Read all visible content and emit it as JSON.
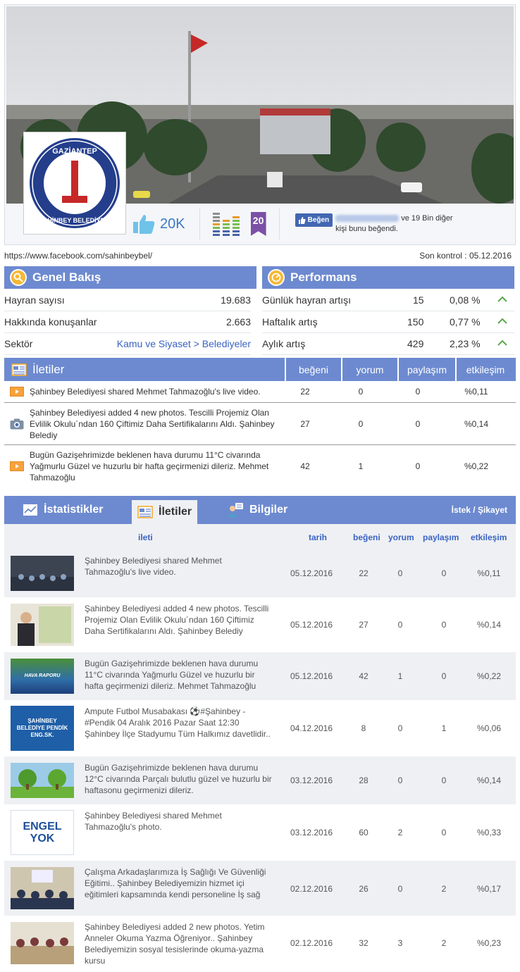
{
  "header": {
    "logo": {
      "text_top": "GAZİANTEP",
      "text_bottom": "ŞAHİNBEY BELEDİYESİ"
    },
    "likes": "20K",
    "rank": "20",
    "fb": {
      "button": "Beğen",
      "text": "ve 19 Bin diğer kişi bunu beğendi."
    }
  },
  "url": "https://www.facebook.com/sahinbeybel/",
  "last_check": "Son kontrol : 05.12.2016",
  "overview": {
    "title": "Genel Bakış",
    "rows": [
      {
        "label": "Hayran sayısı",
        "value": "19.683"
      },
      {
        "label": "Hakkında konuşanlar",
        "value": "2.663"
      },
      {
        "label": "Sektör",
        "value": "Kamu ve Siyaset > Belediyeler"
      }
    ]
  },
  "performance": {
    "title": "Performans",
    "rows": [
      {
        "label": "Günlük hayran artışı",
        "value": "15",
        "pct": "0,08 %"
      },
      {
        "label": "Haftalık artış",
        "value": "150",
        "pct": "0,77 %"
      },
      {
        "label": "Aylık artış",
        "value": "429",
        "pct": "2,23 %"
      }
    ]
  },
  "posts": {
    "headers": [
      "İletiler",
      "beğeni",
      "yorum",
      "paylaşım",
      "etkileşim"
    ],
    "rows": [
      {
        "icon": "video-icon",
        "text": "Şahinbey Belediyesi shared Mehmet Tahmazoğlu's live video.",
        "likes": "22",
        "comments": "0",
        "shares": "0",
        "eng": "%0,11"
      },
      {
        "icon": "camera-icon",
        "text": "Şahinbey Belediyesi added 4 new photos. Tescilli Projemiz Olan Evlilik Okulu´ndan 160 Çiftimiz Daha Sertifikalarını Aldı. Şahinbey Belediy",
        "likes": "27",
        "comments": "0",
        "shares": "0",
        "eng": "%0,14"
      },
      {
        "icon": "video-icon",
        "text": "Bugün Gazişehrimizde beklenen hava durumu 11°C civarında Yağmurlu Güzel ve huzurlu bir hafta geçirmenizi dileriz. Mehmet Tahmazoğlu",
        "likes": "42",
        "comments": "1",
        "shares": "0",
        "eng": "%0,22"
      }
    ]
  },
  "tabs": {
    "stats": "İstatistikler",
    "posts": "İletiler",
    "info": "Bilgiler",
    "request": "İstek / Şikayet"
  },
  "table": {
    "headers": {
      "post": "ileti",
      "date": "tarih",
      "likes": "beğeni",
      "comments": "yorum",
      "shares": "paylaşım",
      "eng": "etkileşim"
    },
    "rows": [
      {
        "text": "Şahinbey Belediyesi shared Mehmet Tahmazoğlu's live video.",
        "date": "05.12.2016",
        "likes": "22",
        "comments": "0",
        "shares": "0",
        "eng": "%0,11"
      },
      {
        "text": "Şahinbey Belediyesi added 4 new photos. Tescilli Projemiz Olan Evlilik Okulu´ndan 160 Çiftimiz Daha Sertifikalarını Aldı. Şahinbey Belediy",
        "date": "05.12.2016",
        "likes": "27",
        "comments": "0",
        "shares": "0",
        "eng": "%0,14"
      },
      {
        "text": "Bugün Gazişehrimizde beklenen hava durumu 11°C civarında Yağmurlu Güzel ve huzurlu bir hafta geçirmenizi dileriz. Mehmet Tahmazoğlu",
        "date": "05.12.2016",
        "likes": "42",
        "comments": "1",
        "shares": "0",
        "eng": "%0,22",
        "thumb_text": "HAVA RAPORU"
      },
      {
        "text": "Ampute Futbol Musabakası ⚽#Şahinbey - #Pendik 04 Aralık 2016 Pazar Saat 12:30 Şahinbey İlçe Stadyumu Tüm Halkımız davetlidir..",
        "date": "04.12.2016",
        "likes": "8",
        "comments": "0",
        "shares": "1",
        "eng": "%0,06",
        "thumb_text": "ŞAHİNBEY BELEDİYE PENDİK ENG.SK."
      },
      {
        "text": "Bugün Gazişehrimizde beklenen hava durumu 12°C civarında Parçalı bulutlu güzel ve huzurlu bir haftasonu geçirmenizi dileriz.",
        "date": "03.12.2016",
        "likes": "28",
        "comments": "0",
        "shares": "0",
        "eng": "%0,14"
      },
      {
        "text": "Şahinbey Belediyesi shared Mehmet Tahmazoğlu's photo.",
        "date": "03.12.2016",
        "likes": "60",
        "comments": "2",
        "shares": "0",
        "eng": "%0,33",
        "thumb_text": "ENGEL YOK"
      },
      {
        "text": "Çalışma Arkadaşlarımıza İş Sağlığı Ve Güvenliği Eğitimi.. Şahinbey Belediyemizin hizmet içi eğitimleri kapsamında kendi personeline İş sağ",
        "date": "02.12.2016",
        "likes": "26",
        "comments": "0",
        "shares": "2",
        "eng": "%0,17"
      },
      {
        "text": "Şahinbey Belediyesi added 2 new photos. Yetim Anneler Okuma Yazma Öğreniyor.. Şahinbey Belediyemizin sosyal tesislerinde okuma-yazma kursu",
        "date": "02.12.2016",
        "likes": "32",
        "comments": "3",
        "shares": "2",
        "eng": "%0,23"
      }
    ]
  }
}
